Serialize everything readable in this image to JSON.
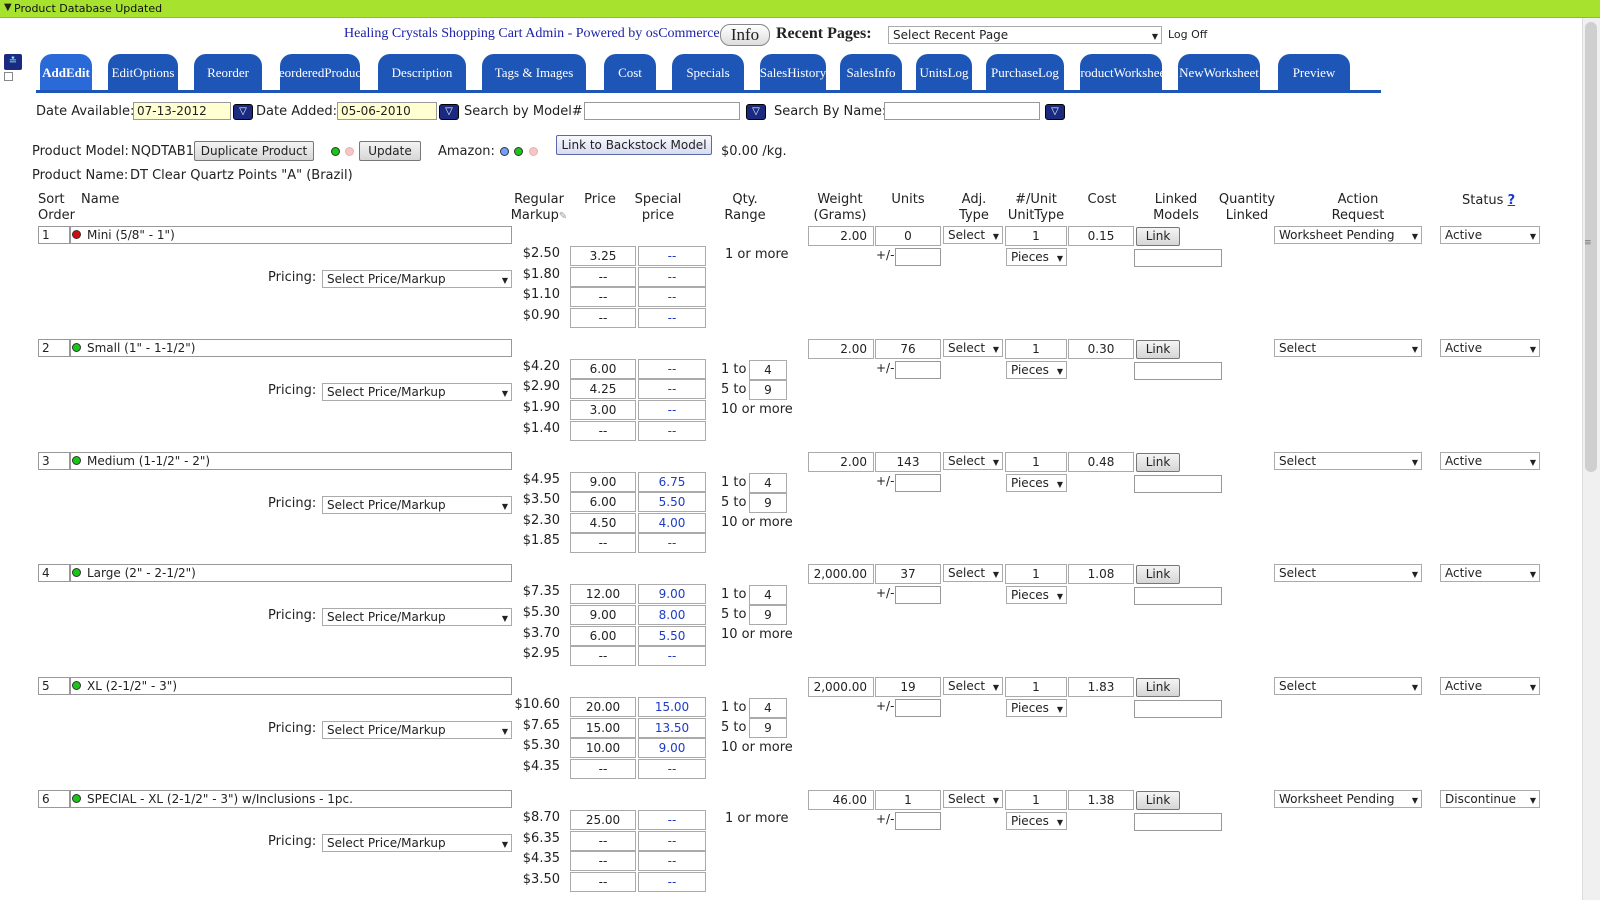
{
  "status_bar": {
    "text": "Product Database Updated"
  },
  "header": {
    "title": "Healing Crystals Shopping Cart Admin - Powered by osCommerce",
    "info_button": "Info",
    "recent_label": "Recent Pages:",
    "recent_select": "Select Recent Page",
    "logoff": "Log Off"
  },
  "tabs": [
    [
      "Add",
      "Edit"
    ],
    [
      "Edit",
      "Options"
    ],
    [
      "Reorder",
      ""
    ],
    [
      "Reordered",
      "Products"
    ],
    [
      "Description",
      ""
    ],
    [
      "Tags & Images",
      ""
    ],
    [
      "Cost",
      ""
    ],
    [
      "Specials",
      ""
    ],
    [
      "Sales",
      "History"
    ],
    [
      "Sales",
      "Info"
    ],
    [
      "Units",
      "Log"
    ],
    [
      "Purchase",
      "Log"
    ],
    [
      "Product",
      "Worksheet"
    ],
    [
      "New",
      "Worksheet"
    ],
    [
      "Preview",
      ""
    ]
  ],
  "filters": {
    "date_available_label": "Date Available:",
    "date_available": "07-13-2012",
    "date_added_label": "Date Added:",
    "date_added": "05-06-2010",
    "search_model_label": "Search by Model#:",
    "search_name_label": "Search By Name:"
  },
  "product": {
    "model_label": "Product Model:",
    "model": "NQDTAB1",
    "duplicate_button": "Duplicate Product",
    "update_button": "Update",
    "amazon_label": "Amazon:",
    "backstock_button": "Link to Backstock Model",
    "per_kg": "$0.00 /kg.",
    "name_label": "Product Name:",
    "name": "DT Clear Quartz Points \"A\" (Brazil)"
  },
  "columns": {
    "sort": "Sort",
    "order": "Order",
    "name": "Name",
    "regular": "Regular",
    "markup": "Markup",
    "price": "Price",
    "special": "Special",
    "special2": "price",
    "qty": "Qty.",
    "range": "Range",
    "weight": "Weight",
    "grams": "(Grams)",
    "units": "Units",
    "adj": "Adj.",
    "type": "Type",
    "perunit": "#/Unit",
    "unittype": "UnitType",
    "cost": "Cost",
    "linked": "Linked",
    "models": "Models",
    "quantity": "Quantity",
    "qlinked": "Linked",
    "action": "Action",
    "request": "Request",
    "status": "Status",
    "help": "?"
  },
  "labels": {
    "pricing": "Pricing:",
    "select_price_markup": "Select Price/Markup",
    "plusminus": "+/-",
    "select": "Select",
    "pieces": "Pieces",
    "link": "Link"
  },
  "rows": [
    {
      "sort": "1",
      "dot": "red",
      "name": "Mini (5/8\" - 1\")",
      "markups": [
        "$2.50",
        "$1.80",
        "$1.10",
        "$0.90"
      ],
      "prices": [
        "3.25",
        "--",
        "--",
        "--"
      ],
      "specials": [
        "--",
        "--",
        "--",
        "--"
      ],
      "qty_single": "1 or more",
      "weight": "2.00",
      "units": "0",
      "perunit": "1",
      "cost": "0.15",
      "action": "Worksheet Pending",
      "status": "Active"
    },
    {
      "sort": "2",
      "dot": "green",
      "name": "Small (1\" - 1-1/2\")",
      "markups": [
        "$4.20",
        "$2.90",
        "$1.90",
        "$1.40"
      ],
      "prices": [
        "6.00",
        "4.25",
        "3.00",
        "--"
      ],
      "specials": [
        "--",
        "--",
        "--",
        "--"
      ],
      "weight": "2.00",
      "units": "76",
      "perunit": "1",
      "cost": "0.30",
      "action": "Select",
      "status": "Active"
    },
    {
      "sort": "3",
      "dot": "green",
      "name": "Medium (1-1/2\" - 2\")",
      "markups": [
        "$4.95",
        "$3.50",
        "$2.30",
        "$1.85"
      ],
      "prices": [
        "9.00",
        "6.00",
        "4.50",
        "--"
      ],
      "specials": [
        "6.75",
        "5.50",
        "4.00",
        "--"
      ],
      "weight": "2.00",
      "units": "143",
      "perunit": "1",
      "cost": "0.48",
      "action": "Select",
      "status": "Active"
    },
    {
      "sort": "4",
      "dot": "green",
      "name": "Large (2\" - 2-1/2\")",
      "markups": [
        "$7.35",
        "$5.30",
        "$3.70",
        "$2.95"
      ],
      "prices": [
        "12.00",
        "9.00",
        "6.00",
        "--"
      ],
      "specials": [
        "9.00",
        "8.00",
        "5.50",
        "--"
      ],
      "weight": "2,000.00",
      "units": "37",
      "perunit": "1",
      "cost": "1.08",
      "action": "Select",
      "status": "Active"
    },
    {
      "sort": "5",
      "dot": "green",
      "name": "XL (2-1/2\" - 3\")",
      "markups": [
        "$10.60",
        "$7.65",
        "$5.30",
        "$4.35"
      ],
      "prices": [
        "20.00",
        "15.00",
        "10.00",
        "--"
      ],
      "specials": [
        "15.00",
        "13.50",
        "9.00",
        "--"
      ],
      "weight": "2,000.00",
      "units": "19",
      "perunit": "1",
      "cost": "1.83",
      "action": "Select",
      "status": "Active"
    },
    {
      "sort": "6",
      "dot": "green",
      "name": "SPECIAL - XL (2-1/2\" - 3\") w/Inclusions - 1pc.",
      "markups": [
        "$8.70",
        "$6.35",
        "$4.35",
        "$3.50"
      ],
      "prices": [
        "25.00",
        "--",
        "--",
        "--"
      ],
      "specials": [
        "--",
        "--",
        "--",
        "--"
      ],
      "qty_single": "1 or more",
      "weight": "46.00",
      "units": "1",
      "perunit": "1",
      "cost": "1.38",
      "action": "Worksheet Pending",
      "status": "Discontinue"
    }
  ],
  "qty_tiers": {
    "a_prefix": "1 to",
    "a_val": "4",
    "b_prefix": "5 to",
    "b_val": "9",
    "c": "10 or more"
  },
  "colors": {
    "status_bar": "#a6e22e",
    "tab": "#1e56b8",
    "title": "#1e22a8",
    "special_text": "#1c3cc8"
  }
}
